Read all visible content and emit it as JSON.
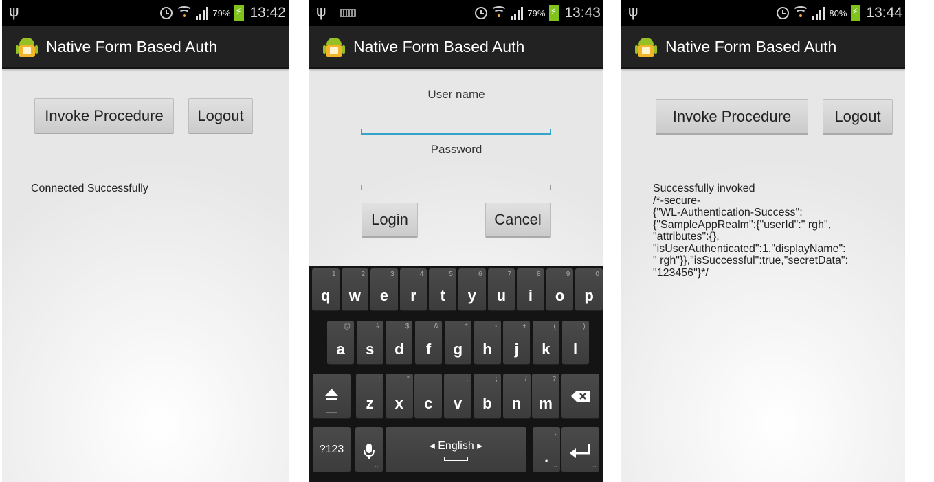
{
  "status_bars": [
    {
      "battery": "79%",
      "time": "13:42",
      "keyboard_indicator": false
    },
    {
      "battery": "79%",
      "time": "13:43",
      "keyboard_indicator": true
    },
    {
      "battery": "80%",
      "time": "13:44",
      "keyboard_indicator": false
    }
  ],
  "app": {
    "title": "Native Form Based Auth",
    "icon": "android-app-icon"
  },
  "screen1": {
    "invoke_label": "Invoke Procedure",
    "logout_label": "Logout",
    "message": "Connected Successfully"
  },
  "screen2": {
    "username_label": "User name",
    "username_value": "",
    "password_label": "Password",
    "password_value": "",
    "login_label": "Login",
    "cancel_label": "Cancel",
    "keyboard": {
      "row1": [
        {
          "k": "q",
          "s": "1"
        },
        {
          "k": "w",
          "s": "2"
        },
        {
          "k": "e",
          "s": "3"
        },
        {
          "k": "r",
          "s": "4"
        },
        {
          "k": "t",
          "s": "5"
        },
        {
          "k": "y",
          "s": "6"
        },
        {
          "k": "u",
          "s": "7"
        },
        {
          "k": "i",
          "s": "8"
        },
        {
          "k": "o",
          "s": "9"
        },
        {
          "k": "p",
          "s": "0"
        }
      ],
      "row2": [
        {
          "k": "a",
          "s": "@"
        },
        {
          "k": "s",
          "s": "#"
        },
        {
          "k": "d",
          "s": "$"
        },
        {
          "k": "f",
          "s": "&"
        },
        {
          "k": "g",
          "s": "*"
        },
        {
          "k": "h",
          "s": "-"
        },
        {
          "k": "j",
          "s": "+"
        },
        {
          "k": "k",
          "s": "("
        },
        {
          "k": "l",
          "s": ")"
        }
      ],
      "row3": [
        {
          "k": "z",
          "s": "!"
        },
        {
          "k": "x",
          "s": "\""
        },
        {
          "k": "c",
          "s": "'"
        },
        {
          "k": "v",
          "s": ":"
        },
        {
          "k": "b",
          "s": ";"
        },
        {
          "k": "n",
          "s": "/"
        },
        {
          "k": "m",
          "s": "?"
        }
      ],
      "symbols_label": "?123",
      "space_label": "◂ English ▸",
      "period_label": ".",
      "comma_hint": ","
    }
  },
  "screen3": {
    "invoke_label": "Invoke Procedure",
    "logout_label": "Logout",
    "message_lines": [
      "Successfully invoked",
      "/*-secure-",
      "{\"WL-Authentication-Success\":",
      "{\"SampleAppRealm\":{\"userId\":\" rgh\",",
      "\"attributes\":{},",
      "\"isUserAuthenticated\":1,\"displayName\":",
      "\" rgh\"}},\"isSuccessful\":true,\"secretData\":",
      "\"123456\"}*/"
    ]
  }
}
